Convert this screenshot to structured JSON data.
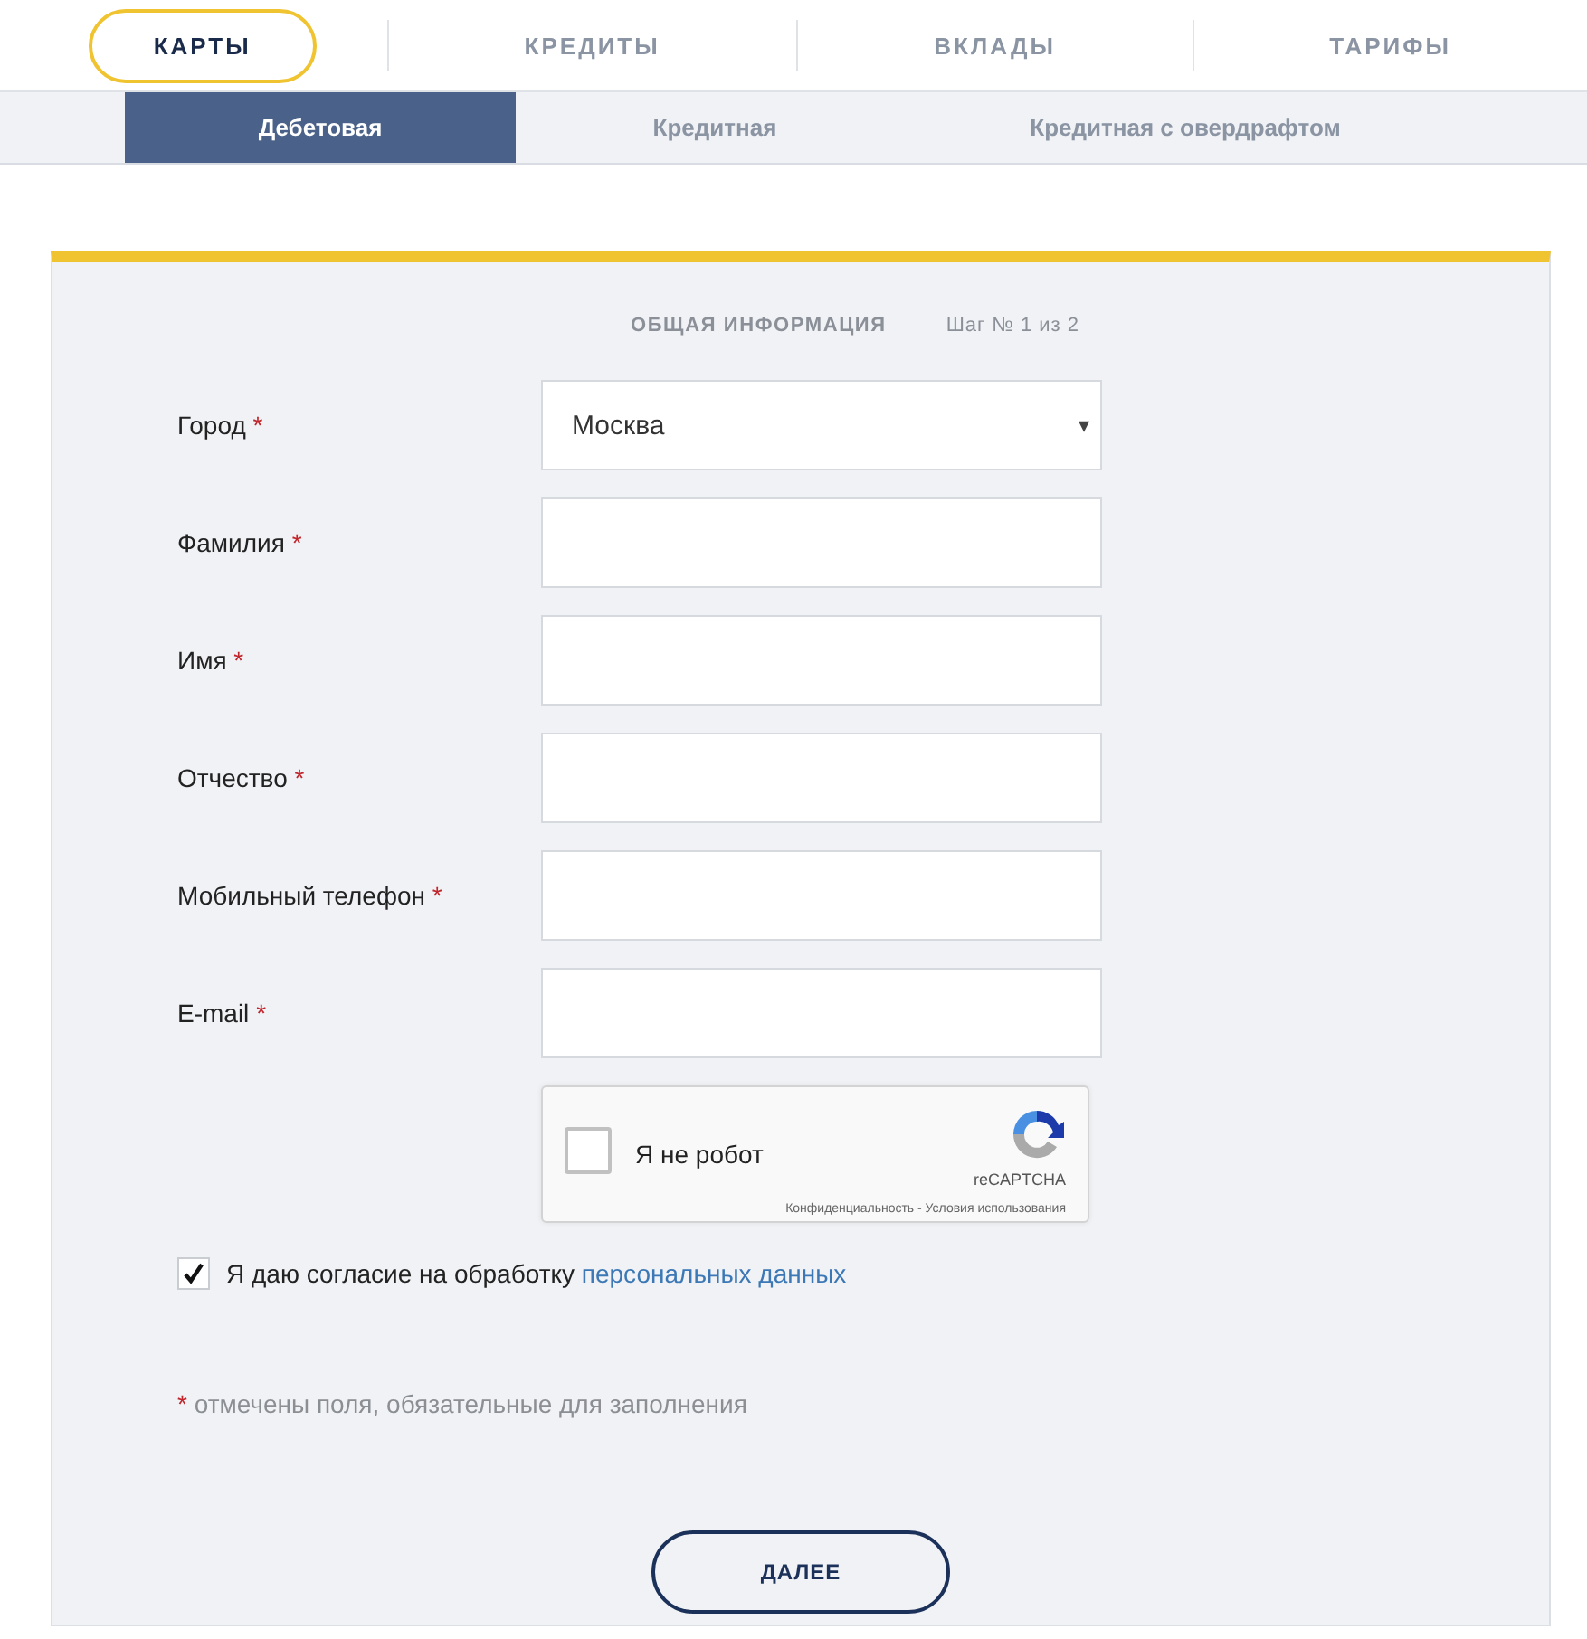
{
  "tabs": [
    {
      "label": "КАРТЫ",
      "selected": true
    },
    {
      "label": "КРЕДИТЫ",
      "selected": false
    },
    {
      "label": "ВКЛАДЫ",
      "selected": false
    },
    {
      "label": "ТАРИФЫ",
      "selected": false
    }
  ],
  "subtabs": [
    {
      "label": "Дебетовая",
      "selected": true
    },
    {
      "label": "Кредитная",
      "selected": false
    },
    {
      "label": "Кредитная с овердрафтом",
      "selected": false
    }
  ],
  "form": {
    "section": "ОБЩАЯ ИНФОРМАЦИЯ",
    "step": "Шаг № 1 из 2",
    "fields": [
      {
        "kind": "select",
        "label": "Город",
        "required_mark": "*",
        "value": "Москва",
        "arrow": "▾"
      },
      {
        "kind": "text",
        "label": "Фамилия",
        "required_mark": "*"
      },
      {
        "kind": "text",
        "label": "Имя",
        "required_mark": "*"
      },
      {
        "kind": "text",
        "label": "Отчество",
        "required_mark": "*"
      },
      {
        "kind": "text",
        "label": "Мобильный телефон",
        "required_mark": "*"
      },
      {
        "kind": "text",
        "label": "E-mail",
        "required_mark": "*"
      }
    ],
    "captcha": {
      "label": "Я не робот",
      "checked": false,
      "brand": "reCAPTCHA",
      "footer": "Конфиденциальность - Условия использования"
    },
    "consent": {
      "checked": true,
      "text": "Я даю согласие на обработку",
      "link": "персональных данных"
    },
    "note": {
      "mark": "*",
      "text": "отмечены поля, обязательные для заполнения"
    },
    "next_button": "ДАЛЕЕ"
  }
}
